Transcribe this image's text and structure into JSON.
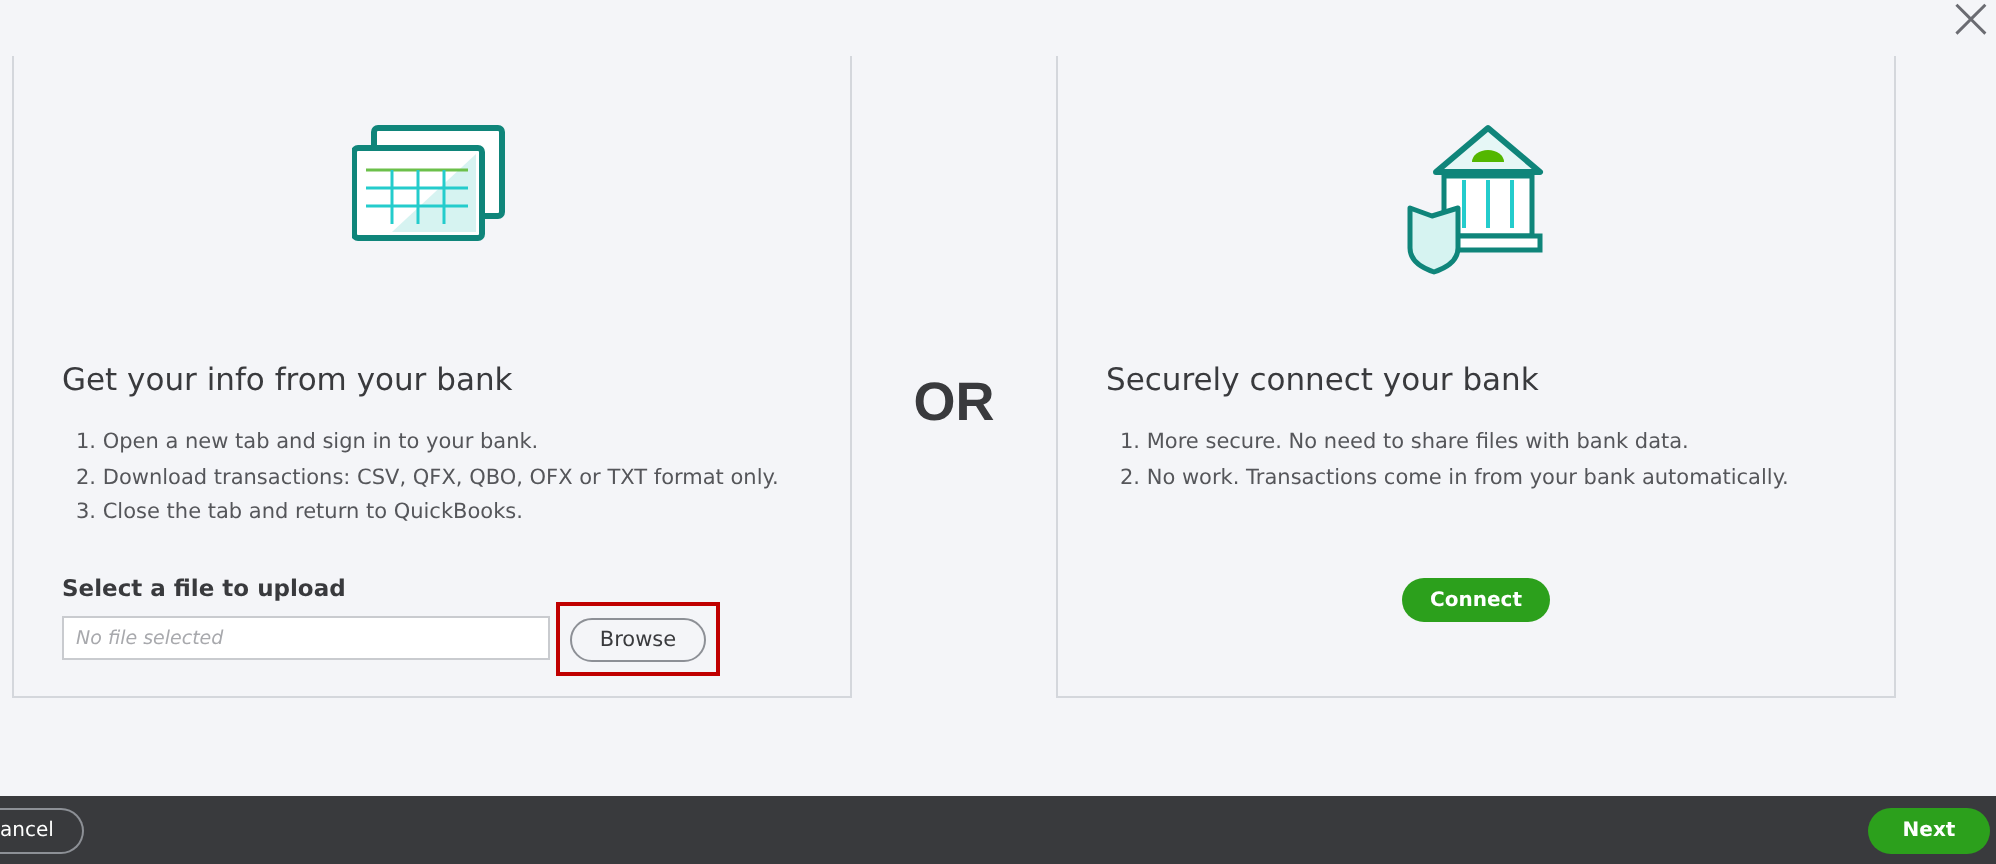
{
  "close": {
    "glyph": "×"
  },
  "options": [
    {
      "kind": "upload",
      "title": "Get your info from your bank",
      "steps": [
        "1. Open a new tab and sign in to your bank.",
        "2. Download transactions: CSV, QFX, QBO, OFX or TXT format only.",
        "3. Close the tab and return to QuickBooks."
      ],
      "file_label": "Select a file to upload",
      "file_field": {
        "placeholder": "No file selected"
      },
      "button": {
        "label": "Browse",
        "highlighted": true
      }
    },
    {
      "kind": "connect",
      "title": "Securely connect your bank",
      "steps": [
        "1. More secure. No need to share files with bank data.",
        "2. No work. Transactions come in from your bank automatically."
      ],
      "button": {
        "label": "Connect",
        "highlighted": false
      }
    }
  ],
  "separator": "OR",
  "footer": {
    "cancel": "ancel",
    "next": "Next"
  }
}
